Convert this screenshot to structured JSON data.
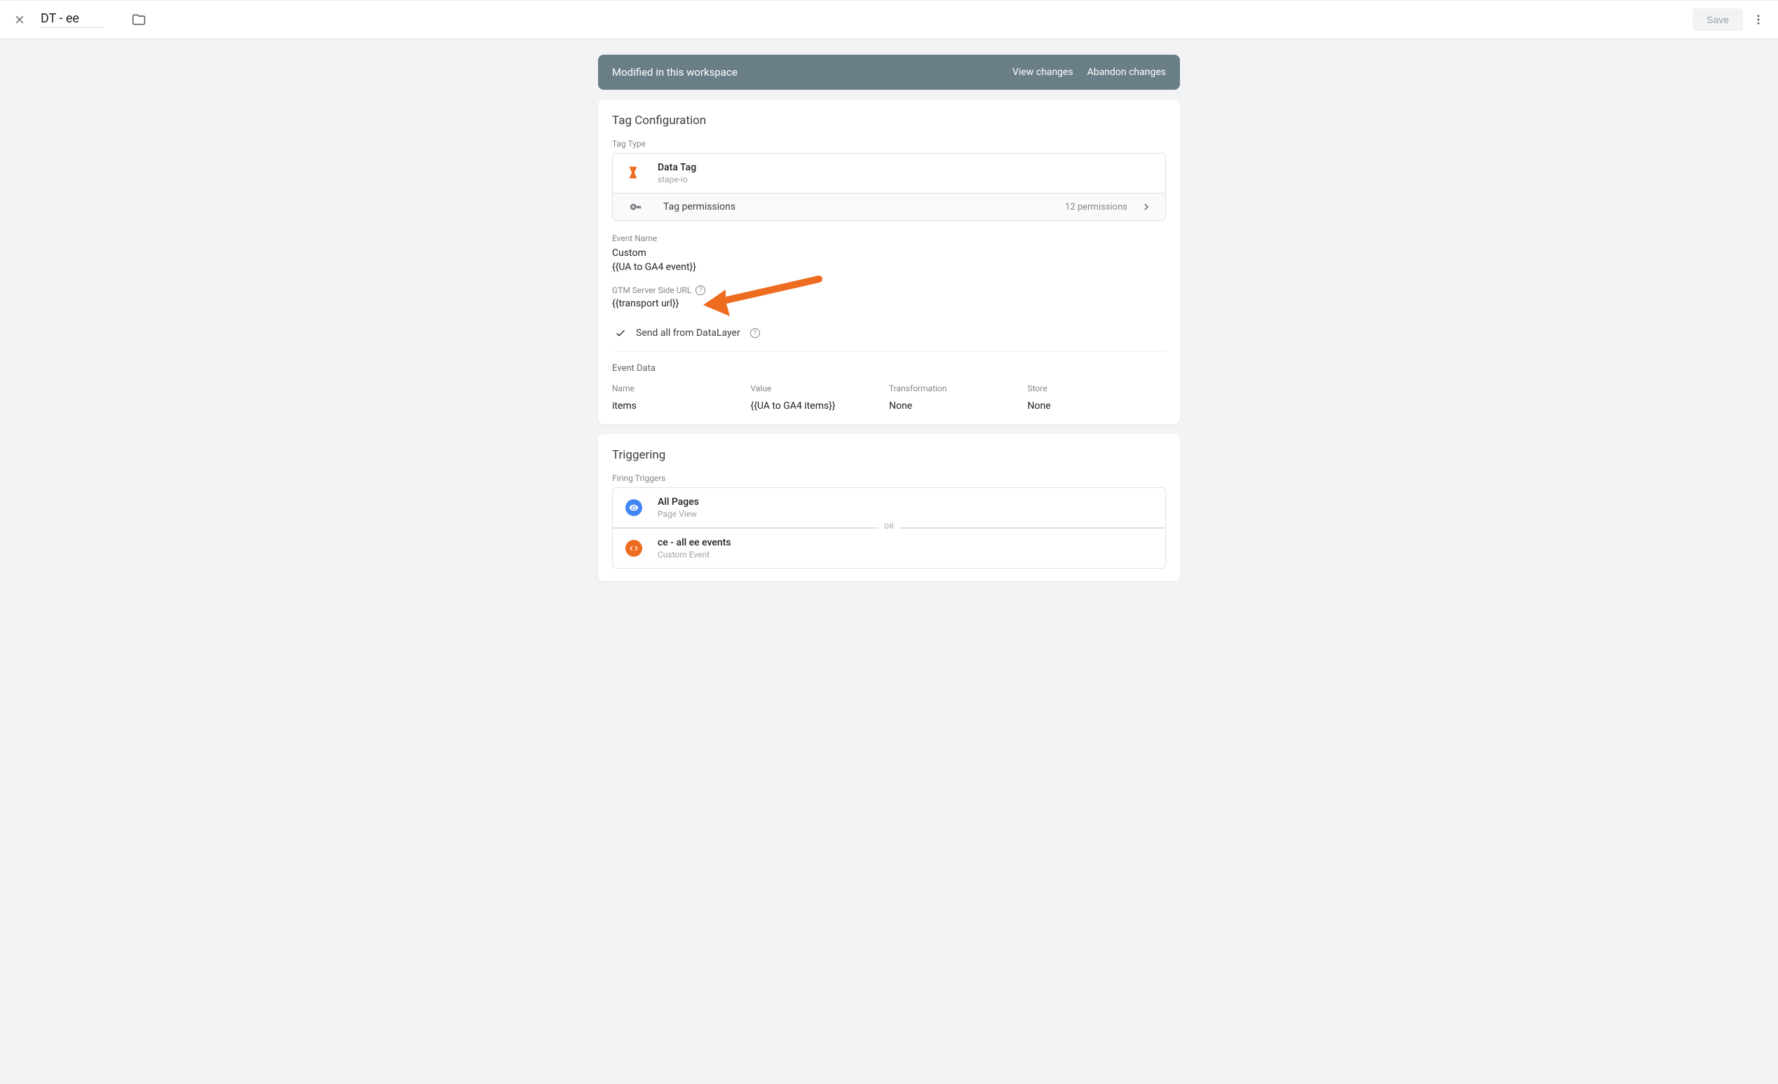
{
  "header": {
    "title": "DT - ee",
    "save_label": "Save"
  },
  "banner": {
    "message": "Modified in this workspace",
    "view_changes": "View changes",
    "abandon_changes": "Abandon changes"
  },
  "config": {
    "title": "Tag Configuration",
    "tag_type_label": "Tag Type",
    "tag_name": "Data Tag",
    "tag_provider": "stape-io",
    "permissions_label": "Tag permissions",
    "permissions_count": "12 permissions",
    "event_name_label": "Event Name",
    "event_name_value": "Custom",
    "event_name_variable": "{{UA to GA4 event}}",
    "server_url_label": "GTM Server Side URL",
    "server_url_value": "{{transport url}}",
    "send_all_label": "Send all from DataLayer",
    "event_data_label": "Event Data",
    "columns": {
      "name": "Name",
      "value": "Value",
      "transformation": "Transformation",
      "store": "Store"
    },
    "event_data_rows": [
      {
        "name": "items",
        "value": "{{UA to GA4 items}}",
        "transformation": "None",
        "store": "None"
      }
    ]
  },
  "triggering": {
    "title": "Triggering",
    "firing_label": "Firing Triggers",
    "or_label": "OR",
    "triggers": [
      {
        "name": "All Pages",
        "type": "Page View"
      },
      {
        "name": "ce - all ee events",
        "type": "Custom Event"
      }
    ]
  }
}
